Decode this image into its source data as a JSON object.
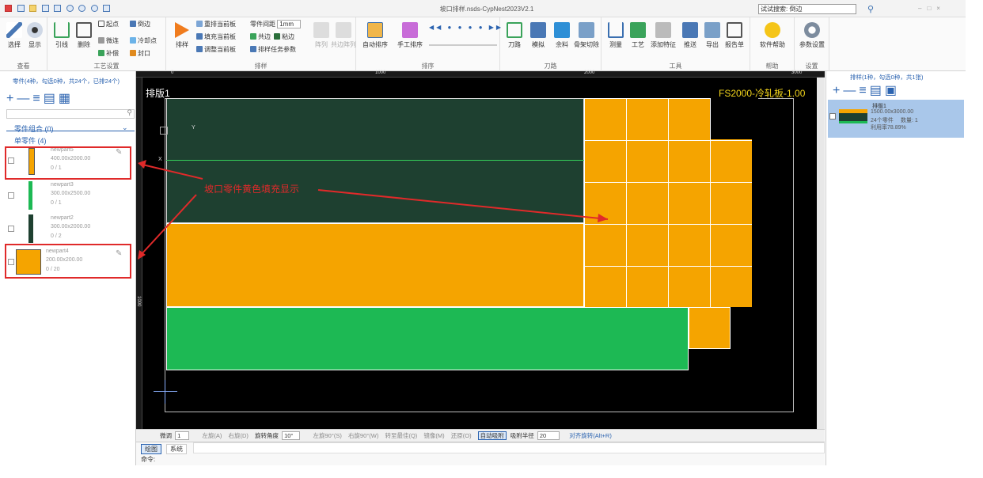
{
  "quick_access_icons": [
    "logo-icon",
    "new-icon",
    "open-icon",
    "save-icon",
    "export-icon",
    "undo-icon",
    "redo-icon",
    "settings-icon",
    "window-icon"
  ],
  "title": "坡口排样.nsds-CypNest2023V2.1",
  "search": {
    "label": "试试搜索:",
    "value": "倒边"
  },
  "ribbon": {
    "view": {
      "select": "选择",
      "display": "显示",
      "group": "查看"
    },
    "process": {
      "lead": "引线",
      "delete": "删除",
      "start_point": "起点",
      "chamfer": "倒边",
      "micro_joint": "微连",
      "cooling_point": "冷却点",
      "compensation": "补偿",
      "seal": "封口",
      "group": "工艺设置"
    },
    "nest": {
      "nest": "排样",
      "renest_current": "重排当前板",
      "fill_current": "填充当前板",
      "adjust_current": "调整当前板",
      "part_spacing": "零件间距",
      "spacing_value": "1mm",
      "common_edge": "共边",
      "glue_edge": "粘边",
      "task_params": "排样任务参数",
      "array": "阵列",
      "common_array": "共边阵列",
      "group": "排样"
    },
    "sort": {
      "auto": "自动排序",
      "manual": "手工排序",
      "group": "排序"
    },
    "path": {
      "tool_path": "刀路",
      "simulate": "模拟",
      "remnant": "余料",
      "skeleton_cut": "骨架切除",
      "group": "刀路"
    },
    "tools": {
      "measure": "测量",
      "craft": "工艺",
      "add_feature": "添加特征",
      "nest": "推送",
      "export": "导出",
      "report": "报告单",
      "group": "工具"
    },
    "help": {
      "help": "软件帮助",
      "group": "帮助"
    },
    "settings": {
      "params": "参数设置",
      "group": "设置"
    }
  },
  "left_panel": {
    "summary": "零件(4种，勾选0种，共24个，已排24个)",
    "combo_label": "零件组合 (0)",
    "single_label": "单零件 (4)",
    "parts": [
      {
        "name": "newpart5",
        "size": "400.00x2000.00",
        "count": "0 / 1",
        "color": "#f5a400"
      },
      {
        "name": "newpart3",
        "size": "300.00x2500.00",
        "count": "0 / 1",
        "color": "#1db954"
      },
      {
        "name": "newpart2",
        "size": "300.00x2000.00",
        "count": "0 / 2",
        "color": "#1e4030"
      },
      {
        "name": "newpart4",
        "size": "200.00x200.00",
        "count": "0 / 20",
        "color": "#f5a400"
      }
    ]
  },
  "canvas": {
    "sheet_label": "排版1",
    "material_label": "FS2000-冷轧板-1.00",
    "ruler_top": [
      "0",
      "1000",
      "2000",
      "3000"
    ],
    "ruler_left": [
      "1000"
    ],
    "annotation": "坡口零件黄色填充显示",
    "axis_x": "X",
    "axis_y": "Y"
  },
  "status_bar": {
    "items": [
      "微调",
      "1",
      "左旋(A)",
      "右旋(D)",
      "旋转角度",
      "10°",
      "左旋90°(S)",
      "右旋90°(W)",
      "转至最佳(Q)",
      "镜像(M)",
      "还原(O)",
      "自动吸附",
      "吸附半径",
      "20",
      "对齐旋转(Alt+R)"
    ]
  },
  "bottom_tabs": [
    "绘图",
    "系统"
  ],
  "bottom_text": "命令:",
  "right_panel": {
    "summary": "排样(1种，勾选0种，共1张)",
    "sheet": {
      "name": "排版1",
      "size": "1500.00x3000.00",
      "parts": "24个零件",
      "qty": "数量: 1",
      "utilization": "利用率78.89%"
    }
  },
  "colors": {
    "orange": "#f5a400",
    "green": "#1db954",
    "dark_green": "#1e4030",
    "annotation_red": "#e02a2a",
    "material_yellow": "#f3d51b"
  }
}
